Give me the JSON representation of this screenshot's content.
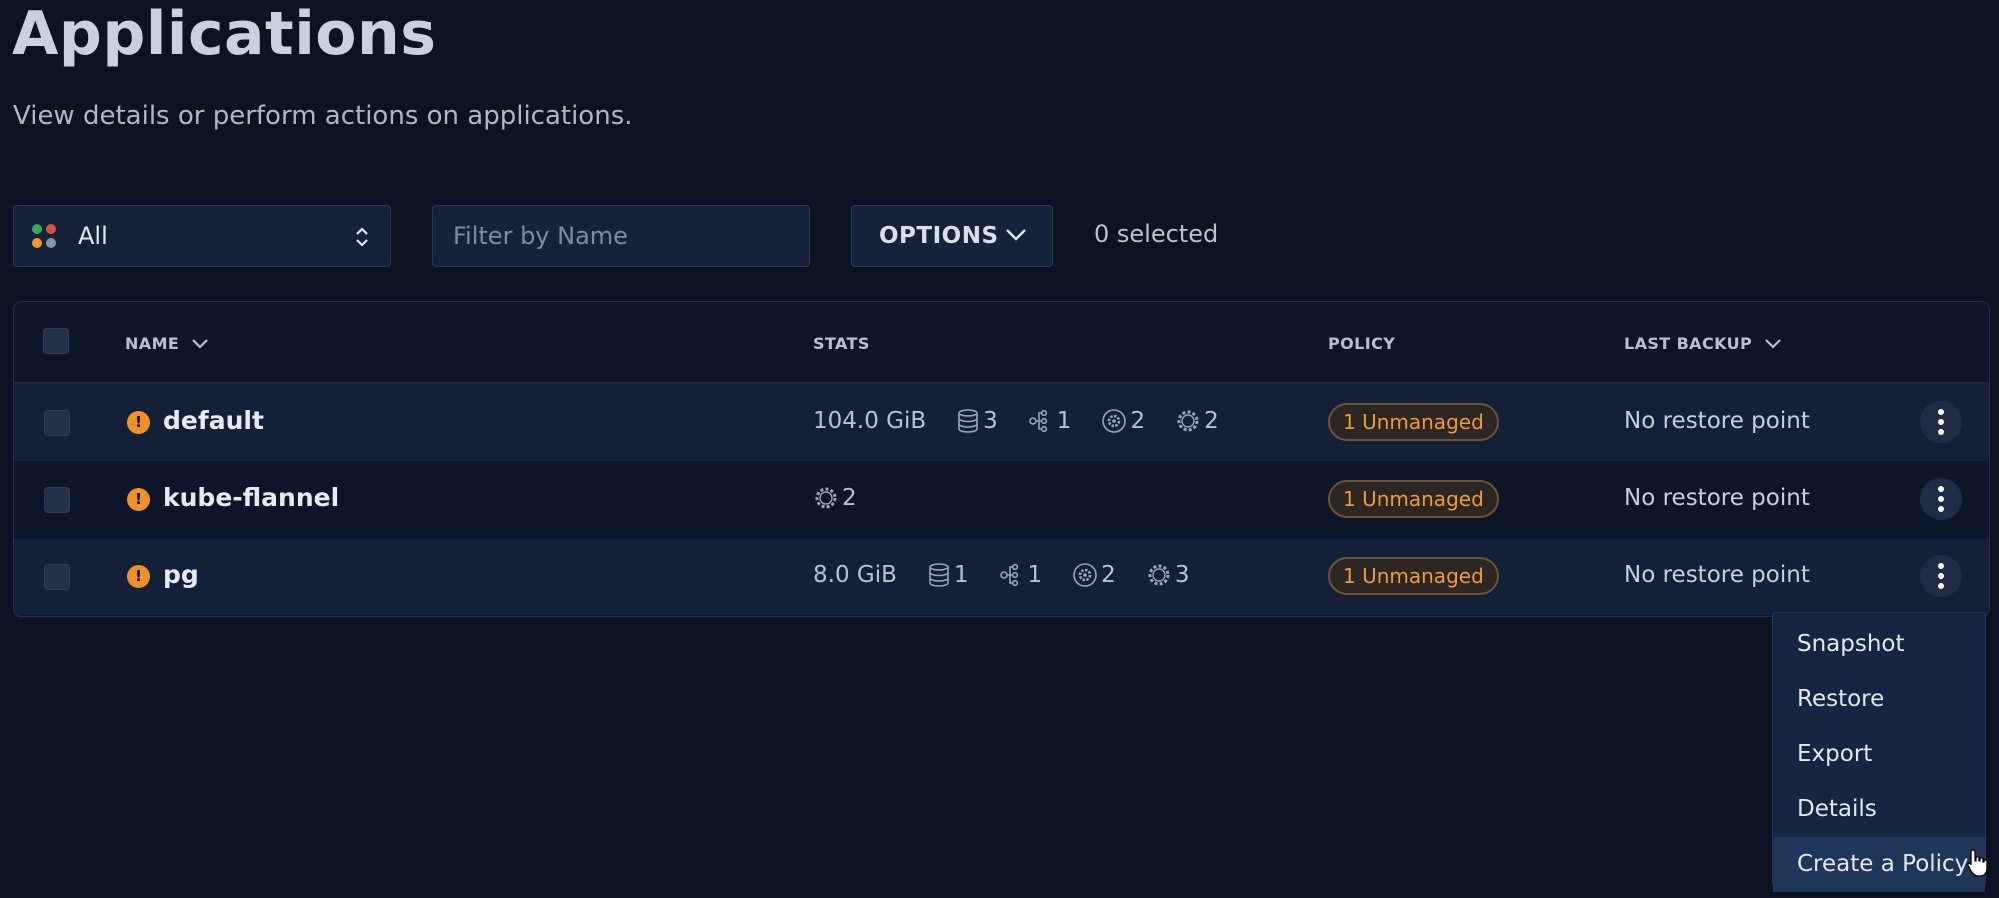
{
  "page": {
    "title": "Applications",
    "subtitle": "View details or perform actions on applications."
  },
  "toolbar": {
    "namespace_select": {
      "value": "All",
      "dot_colors": [
        "#3aa55d",
        "#d9533f",
        "#f09a2c",
        "#8a96a8"
      ]
    },
    "filter": {
      "placeholder": "Filter by Name",
      "value": ""
    },
    "options_label": "OPTIONS",
    "selected_count": "0 selected"
  },
  "table": {
    "columns": {
      "name": "NAME",
      "stats": "STATS",
      "policy": "POLICY",
      "last_backup": "LAST BACKUP"
    },
    "rows": [
      {
        "name": "default",
        "status_icon": "warning-icon",
        "size": "104.0 GiB",
        "volumes": "3",
        "services": "1",
        "secrets": "2",
        "configs": "2",
        "policy": "1 Unmanaged",
        "last_backup": "No restore point"
      },
      {
        "name": "kube-flannel",
        "status_icon": "warning-icon",
        "configs": "2",
        "policy": "1 Unmanaged",
        "last_backup": "No restore point"
      },
      {
        "name": "pg",
        "status_icon": "warning-icon",
        "size": "8.0 GiB",
        "volumes": "1",
        "services": "1",
        "secrets": "2",
        "configs": "3",
        "policy": "1 Unmanaged",
        "last_backup": "No restore point"
      }
    ]
  },
  "context_menu": {
    "items": [
      "Snapshot",
      "Restore",
      "Export",
      "Details",
      "Create a Policy"
    ],
    "hovered": "Create a Policy"
  },
  "colors": {
    "background": "#0b1222",
    "warning": "#f0902a",
    "badge_text": "#ef9a3c"
  }
}
